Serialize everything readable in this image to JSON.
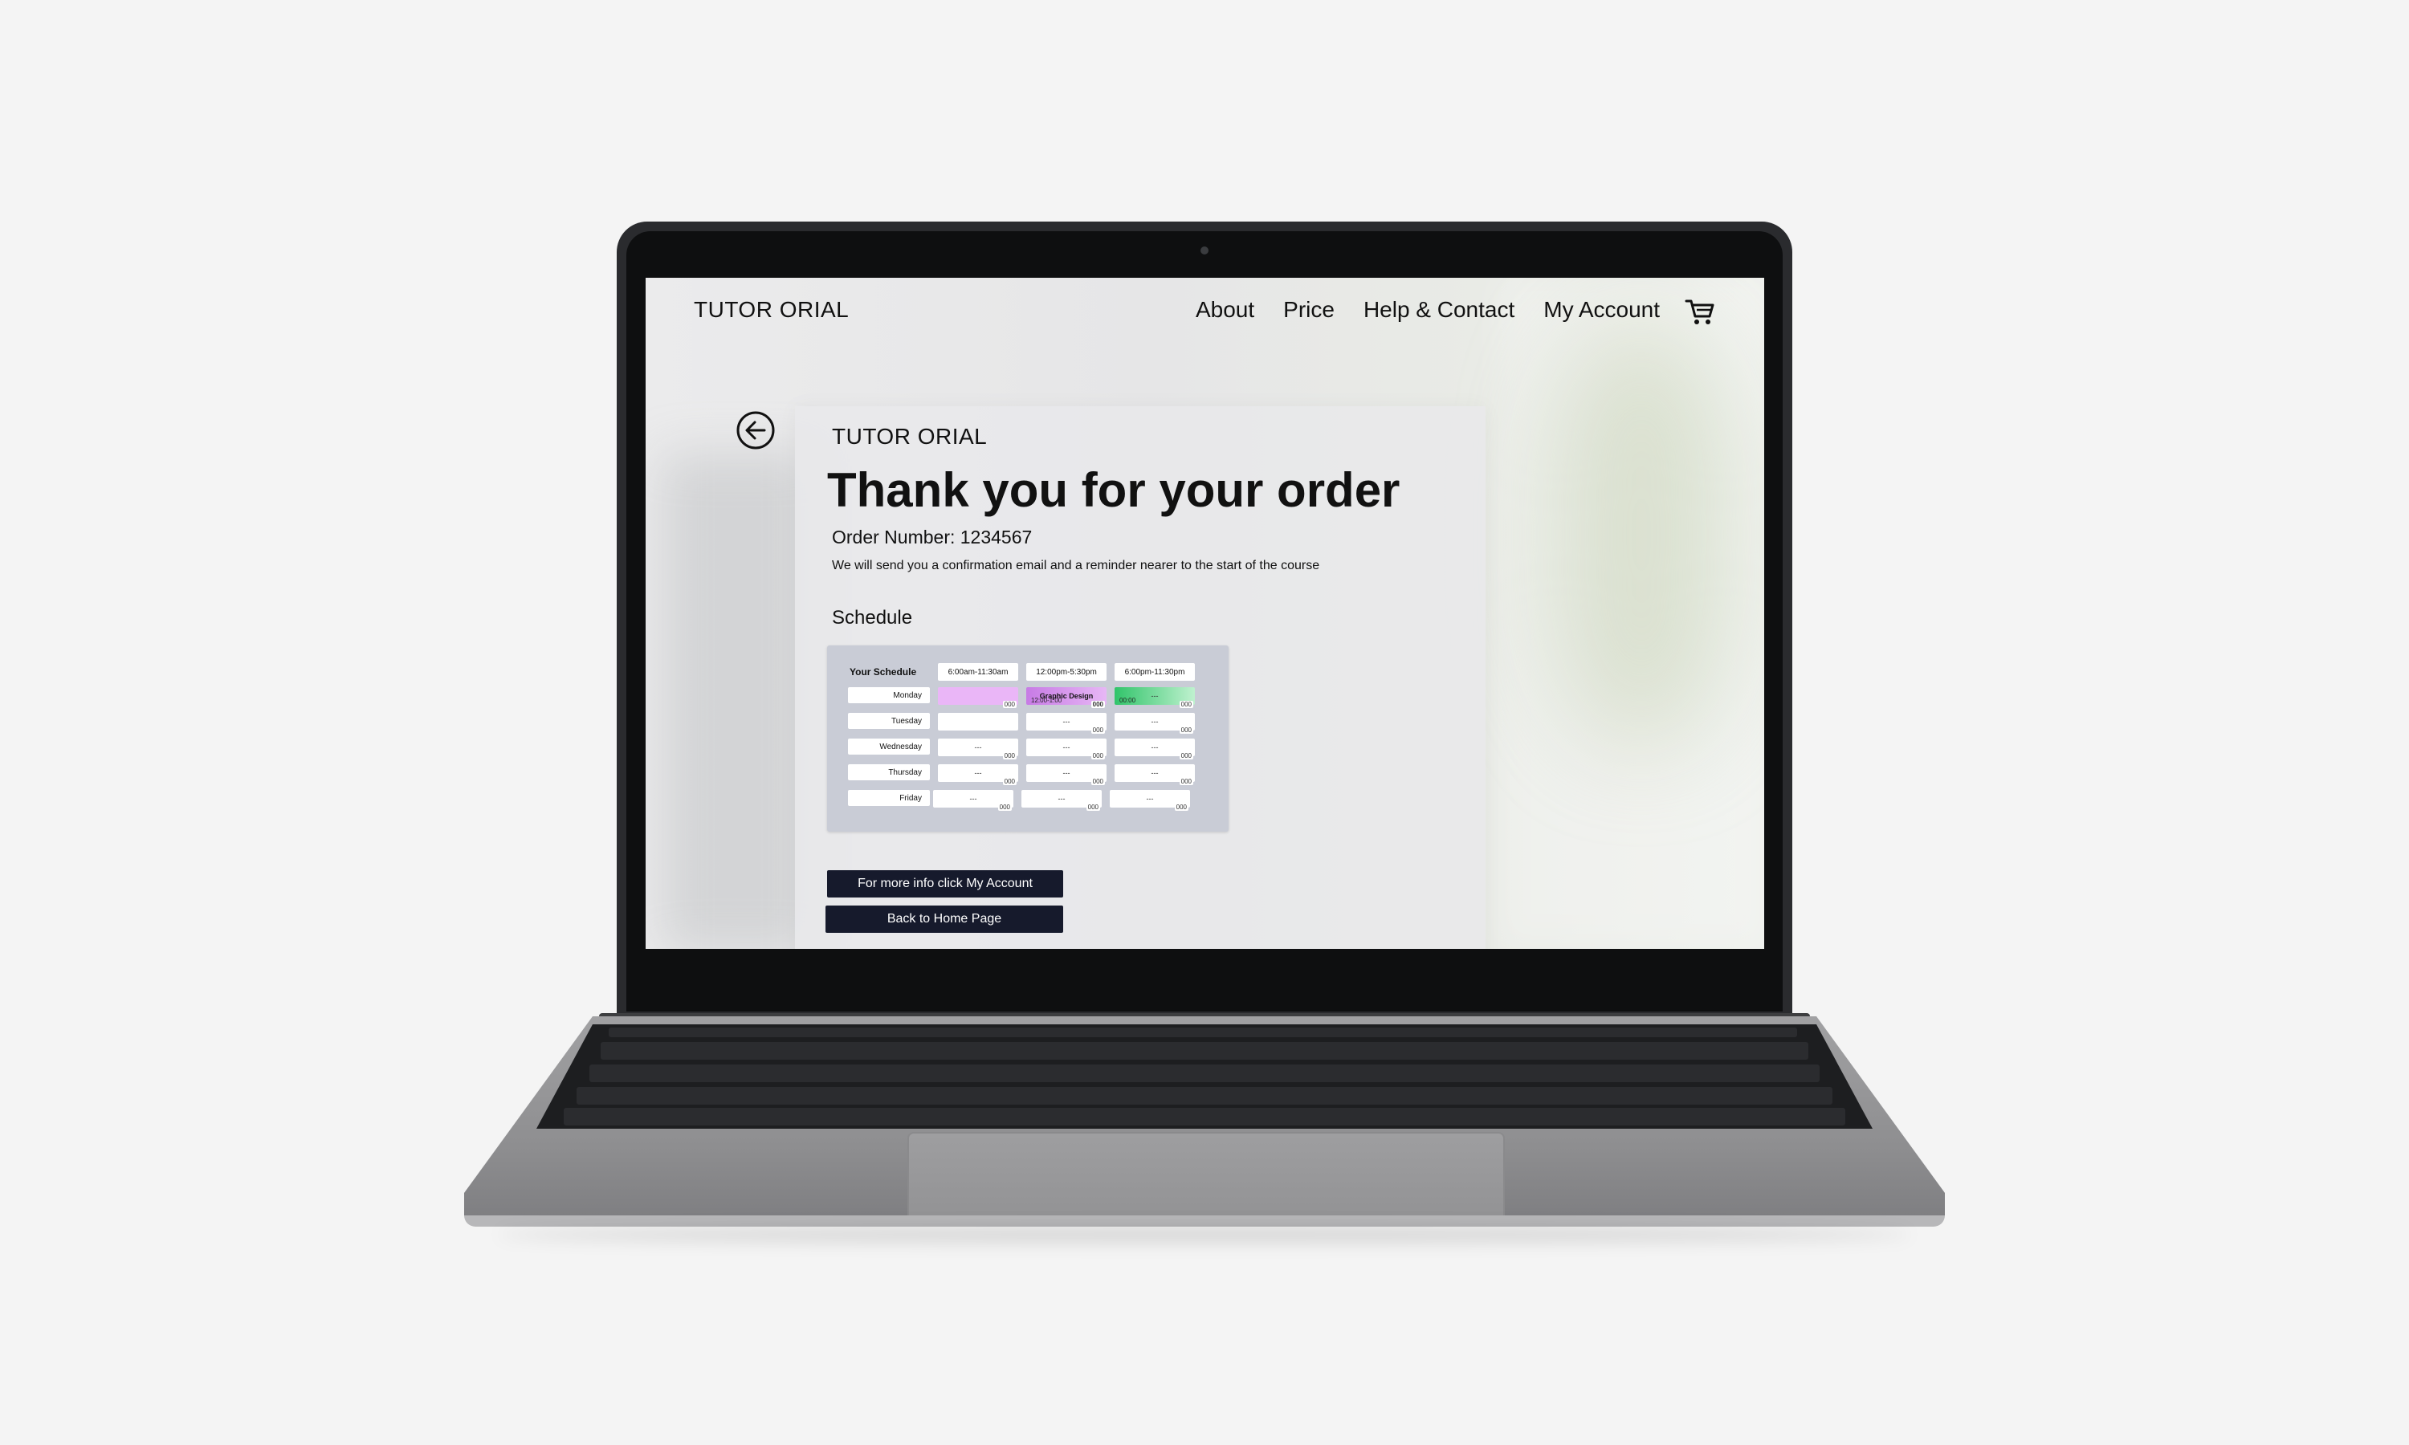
{
  "header": {
    "brand": "TUTOR ORIAL",
    "nav": [
      {
        "label": "About"
      },
      {
        "label": "Price"
      },
      {
        "label": "Help & Contact"
      },
      {
        "label": "My Account"
      }
    ],
    "cart_icon": "cart-icon"
  },
  "main": {
    "back_icon": "arrow-left-circle-icon",
    "card_brand": "TUTOR ORIAL",
    "title": "Thank you for your order",
    "order_number": "Order Number: 1234567",
    "message": "We will send you a confirmation email and a reminder nearer to the start of the course",
    "schedule_heading": "Schedule",
    "schedule": {
      "title": "Your Schedule",
      "times": [
        "6:00am-11:30am",
        "12:00pm-5:30pm",
        "6:00pm-11:30pm"
      ],
      "days": [
        "Monday",
        "Tuesday",
        "Wednesday",
        "Thursday",
        "Friday"
      ],
      "placeholder": "---",
      "dots": "000",
      "monday_course": "Graphic Design",
      "monday_course_time": "12:00-1:00",
      "monday_evening_time": "00:00",
      "colors": {
        "pink": "#eab6f7",
        "purple": "#c77be5",
        "green": "#31c46a",
        "panel": "#c9ccd6"
      }
    },
    "buttons": {
      "account": "For more info click My Account",
      "home": "Back to Home Page"
    },
    "colors": {
      "button_bg": "#161a2c"
    }
  }
}
